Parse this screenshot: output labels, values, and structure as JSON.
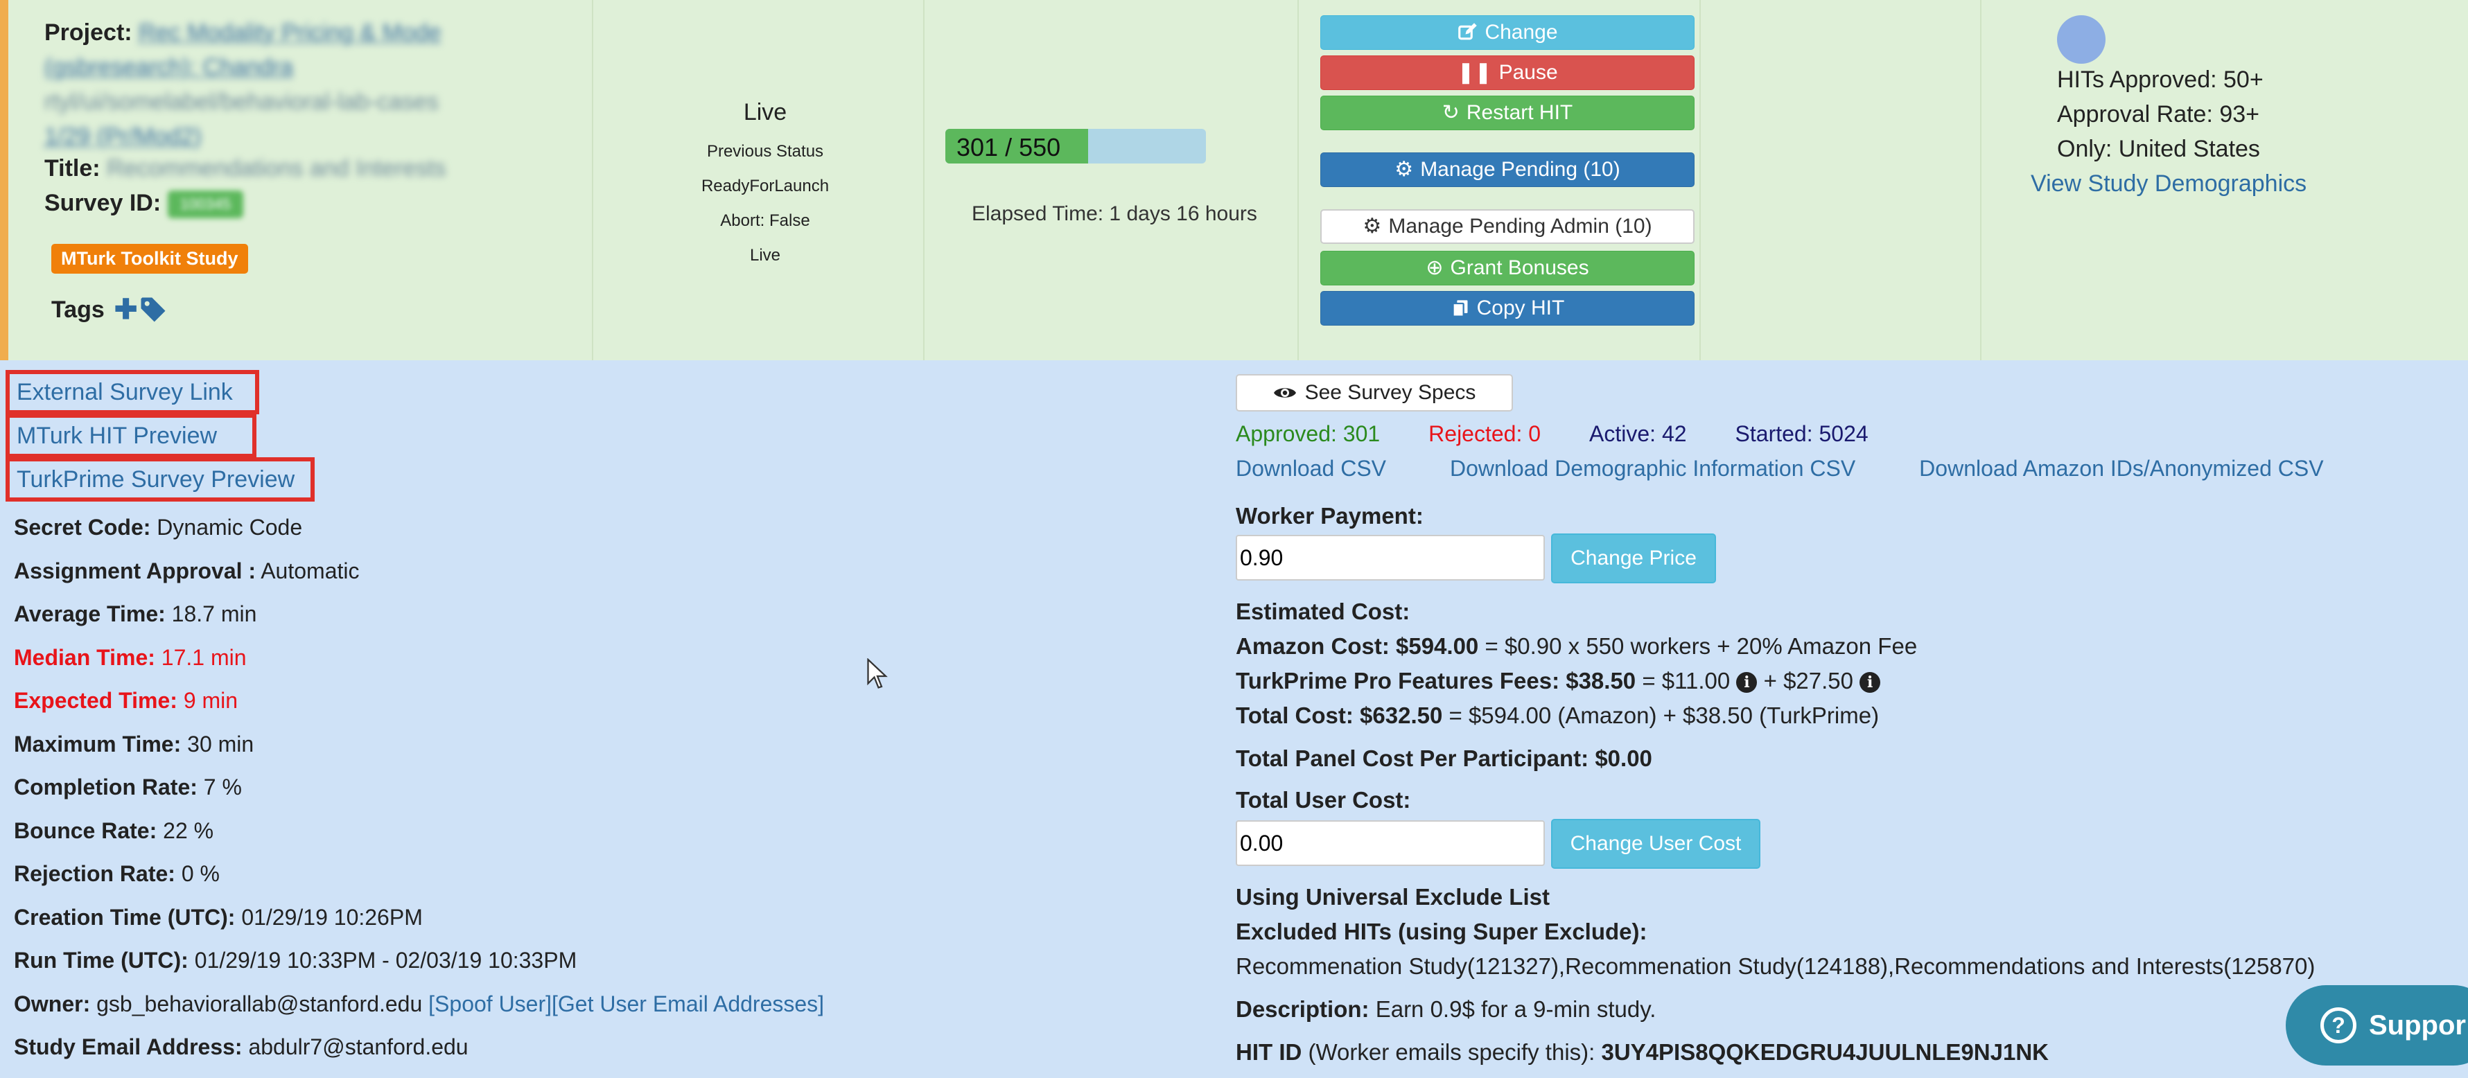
{
  "top": {
    "project": {
      "label": "Project:",
      "value_line1": "Rec Modality Pricing & Mode",
      "value_line2": "(gsbresearch): Chandra",
      "value_line3": "rtyl/ui/somelabel/behavioral-lab-cases",
      "value_line4": "1/29 (Pr/Mod2)"
    },
    "title": {
      "label": "Title:",
      "value": "Recommendations and Interests"
    },
    "survey_id": {
      "label": "Survey ID:",
      "value": "100345"
    },
    "toolkit_badge": "MTurk Toolkit Study",
    "tags_label": "Tags",
    "status": {
      "current": "Live",
      "previous_label": "Previous Status",
      "previous_value": "ReadyForLaunch",
      "abort": "Abort: False",
      "live": "Live"
    },
    "progress": {
      "text": "301 / 550",
      "completed": 301,
      "total": 550
    },
    "elapsed": "Elapsed Time: 1 days 16 hours",
    "buttons": {
      "change": "Change",
      "pause": "Pause",
      "restart": "Restart HIT",
      "manage_pending": "Manage Pending (10)",
      "manage_pending_admin": "Manage Pending Admin (10)",
      "grant_bonuses": "Grant Bonuses",
      "copy_hit": "Copy HIT"
    },
    "worker_reqs": {
      "approved": "HITs Approved: 50+",
      "rate": "Approval Rate: 93+",
      "location": "Only: United States",
      "demographics_link": "View Study Demographics"
    }
  },
  "links": {
    "external": "External Survey Link",
    "mturk_preview": "MTurk HIT Preview",
    "turkprime_preview": "TurkPrime Survey Preview"
  },
  "info": {
    "secret_code": {
      "label": "Secret Code:",
      "value": "Dynamic Code"
    },
    "approval": {
      "label": "Assignment Approval :",
      "value": "Automatic"
    },
    "avg_time": {
      "label": "Average Time:",
      "value": "18.7 min"
    },
    "median_time": {
      "label": "Median Time:",
      "value": "17.1 min"
    },
    "expected_time": {
      "label": "Expected Time:",
      "value": "9 min"
    },
    "max_time": {
      "label": "Maximum Time:",
      "value": "30 min"
    },
    "completion_rate": {
      "label": "Completion Rate:",
      "value": "7 %"
    },
    "bounce_rate": {
      "label": "Bounce Rate:",
      "value": "22 %"
    },
    "rejection_rate": {
      "label": "Rejection Rate:",
      "value": "0 %"
    },
    "creation_time": {
      "label": "Creation Time (UTC):",
      "value": "01/29/19 10:26PM"
    },
    "run_time": {
      "label": "Run Time (UTC):",
      "value": "01/29/19 10:33PM - 02/03/19 10:33PM"
    },
    "owner": {
      "label": "Owner:",
      "value": "gsb_behaviorallab@stanford.edu",
      "spoof": "[Spoof User]",
      "emails": "[Get User Email Addresses]"
    },
    "study_email": {
      "label": "Study Email Address:",
      "value": "abdulr7@stanford.edu"
    }
  },
  "right": {
    "see_specs": "See Survey Specs",
    "stats": {
      "approved": "Approved: 301",
      "rejected": "Rejected: 0",
      "active": "Active: 42",
      "started": "Started: 5024"
    },
    "downloads": {
      "csv": "Download CSV",
      "demographic": "Download Demographic Information CSV",
      "amazon_ids": "Download Amazon IDs/Anonymized CSV"
    },
    "worker_payment": {
      "label": "Worker Payment:",
      "value": "0.90",
      "button": "Change Price"
    },
    "estimated_cost_label": "Estimated Cost:",
    "amazon_cost": {
      "label": "Amazon Cost: $594.00",
      "detail": "= $0.90 x 550 workers + 20% Amazon Fee"
    },
    "pro_fees": {
      "label": "TurkPrime Pro Features Fees: $38.50",
      "part1": "= $11.00",
      "part2": "+ $27.50"
    },
    "total_cost": {
      "label": "Total Cost: $632.50",
      "detail": "= $594.00 (Amazon) + $38.50 (TurkPrime)"
    },
    "panel_cost": "Total Panel Cost Per Participant: $0.00",
    "user_cost": {
      "label": "Total User Cost:",
      "value": "0.00",
      "button": "Change User Cost"
    },
    "universal_exclude": "Using Universal Exclude List",
    "excluded_label": "Excluded HITs (using Super Exclude):",
    "excluded_value": "Recommenation Study(121327),Recommenation Study(124188),Recommendations and Interests(125870)",
    "description": {
      "label": "Description:",
      "value": "Earn 0.9$ for a 9-min study."
    },
    "hit_id": {
      "label": "HIT ID",
      "note": "(Worker emails specify this):",
      "value": "3UY4PIS8QQKEDGRU4JUULNLE9NJ1NK"
    }
  },
  "support_label": "Suppor",
  "colors": {
    "top_bg": "#dff0d8",
    "bottom_bg": "#cfe2f7",
    "accent_orange": "#f0ad4e",
    "highlight_red": "#e0302a",
    "link_blue": "#2e6da4"
  }
}
